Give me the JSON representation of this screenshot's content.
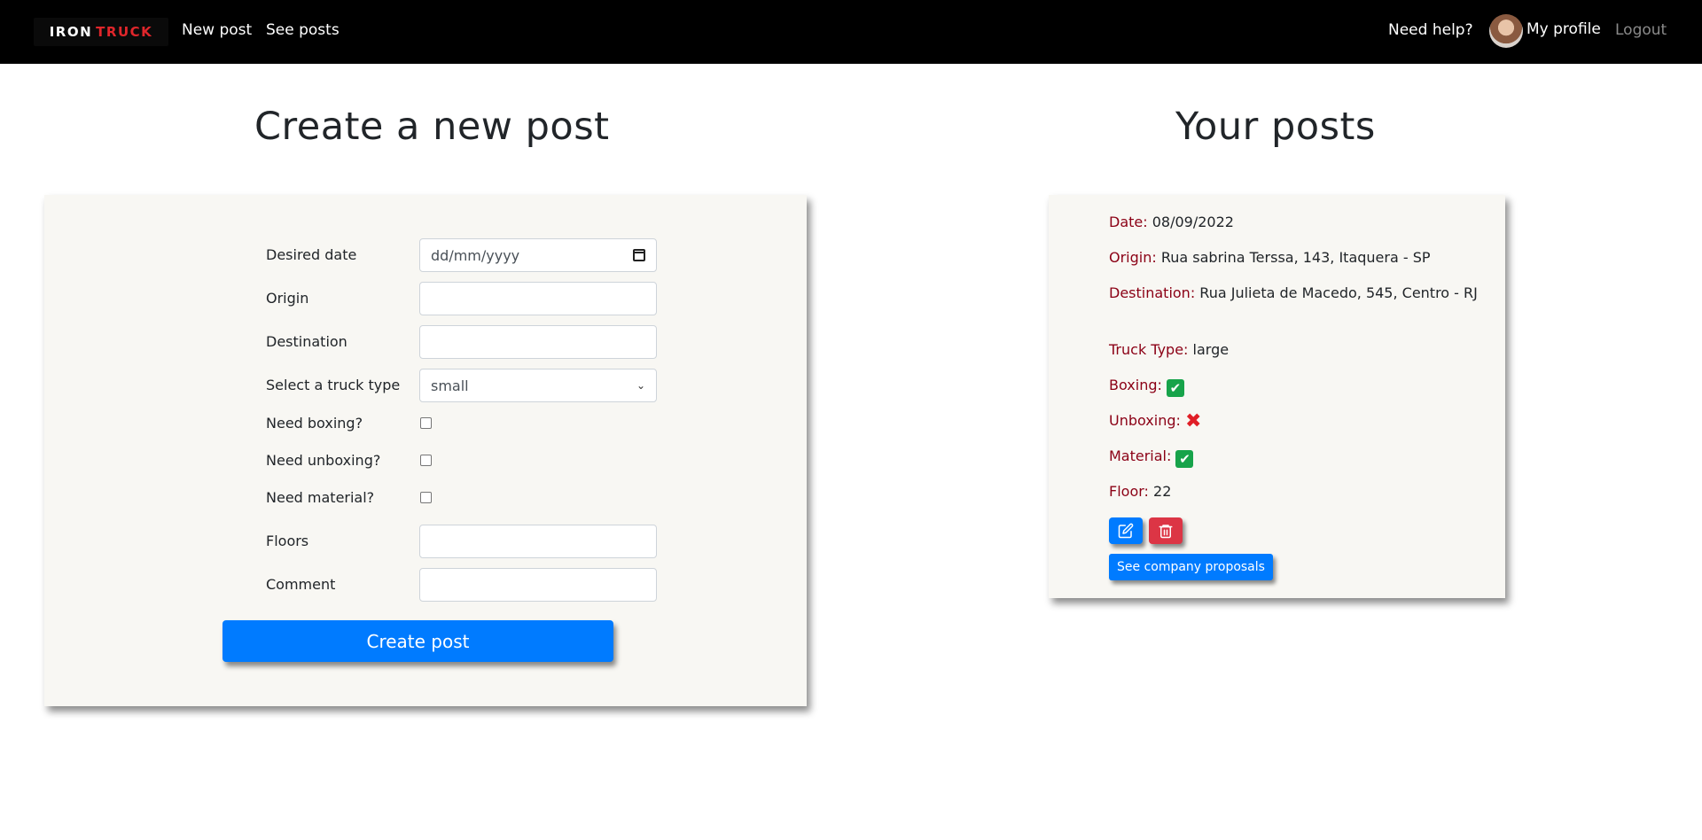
{
  "navbar": {
    "brand_iron": "IRON",
    "brand_truck": "TRUCK",
    "new_post": "New post",
    "see_posts": "See posts",
    "need_help": "Need help?",
    "my_profile": "My profile",
    "logout": "Logout"
  },
  "create": {
    "title": "Create a new post",
    "fields": {
      "desired_date": {
        "label": "Desired date",
        "placeholder": "dd/mm/yyyy"
      },
      "origin": {
        "label": "Origin",
        "value": ""
      },
      "destination": {
        "label": "Destination",
        "value": ""
      },
      "truck_type": {
        "label": "Select a truck type",
        "selected": "small"
      },
      "boxing": {
        "label": "Need boxing?",
        "checked": false
      },
      "unboxing": {
        "label": "Need unboxing?",
        "checked": false
      },
      "material": {
        "label": "Need material?",
        "checked": false
      },
      "floors": {
        "label": "Floors",
        "value": ""
      },
      "comment": {
        "label": "Comment",
        "value": ""
      }
    },
    "submit": "Create post"
  },
  "posts": {
    "title": "Your posts",
    "items": [
      {
        "date_label": "Date:",
        "date": "08/09/2022",
        "origin_label": "Origin:",
        "origin": "Rua sabrina Terssa, 143, Itaquera - SP",
        "destination_label": "Destination:",
        "destination": "Rua Julieta de Macedo, 545, Centro - RJ",
        "truck_label": "Truck Type:",
        "truck": "large",
        "boxing_label": "Boxing:",
        "boxing": "✔",
        "unboxing_label": "Unboxing:",
        "unboxing": "✖",
        "material_label": "Material:",
        "material": "✔",
        "floor_label": "Floor:",
        "floor": "22",
        "proposals_button": "See company proposals"
      }
    ]
  },
  "colors": {
    "navbar_bg": "#000000",
    "primary": "#007bff",
    "danger": "#dc3545",
    "post_key": "#8b0015",
    "card_bg": "#f8f7f3"
  }
}
